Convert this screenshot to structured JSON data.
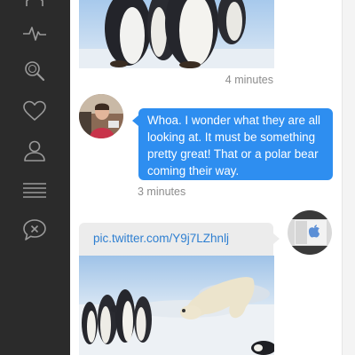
{
  "sidebar": {
    "items": [
      {
        "name": "home",
        "icon": "home-icon"
      },
      {
        "name": "activity",
        "icon": "activity-pulse-icon"
      },
      {
        "name": "search",
        "icon": "search-icon"
      },
      {
        "name": "favorites",
        "icon": "heart-icon"
      },
      {
        "name": "profile",
        "icon": "user-icon"
      },
      {
        "name": "lists",
        "icon": "list-icon"
      },
      {
        "name": "messages",
        "icon": "message-icon"
      }
    ],
    "icon_color": "#9a9a9a",
    "background": "#2b2b2b"
  },
  "conversation": {
    "messages": [
      {
        "type": "photo",
        "image": "penguins-photo",
        "timestamp": "4 minutes"
      },
      {
        "type": "text",
        "direction": "incoming",
        "avatar": "woman-avatar",
        "text": "Whoa. I wonder what they are all looking at. It must be something pretty great! That or a polar bear coming their way.",
        "timestamp": "3 minutes"
      },
      {
        "type": "link",
        "direction": "outgoing",
        "avatar": "apple-logo-avatar",
        "text": "pic.twitter.com/Y9j7LZhnlj",
        "image": "polar-bear-penguins-photo"
      }
    ]
  },
  "colors": {
    "incoming_bubble": "#2e8ef0",
    "outgoing_bubble": "#ececec",
    "link": "#2e7fd1",
    "timestamp": "#8c8c8c"
  }
}
